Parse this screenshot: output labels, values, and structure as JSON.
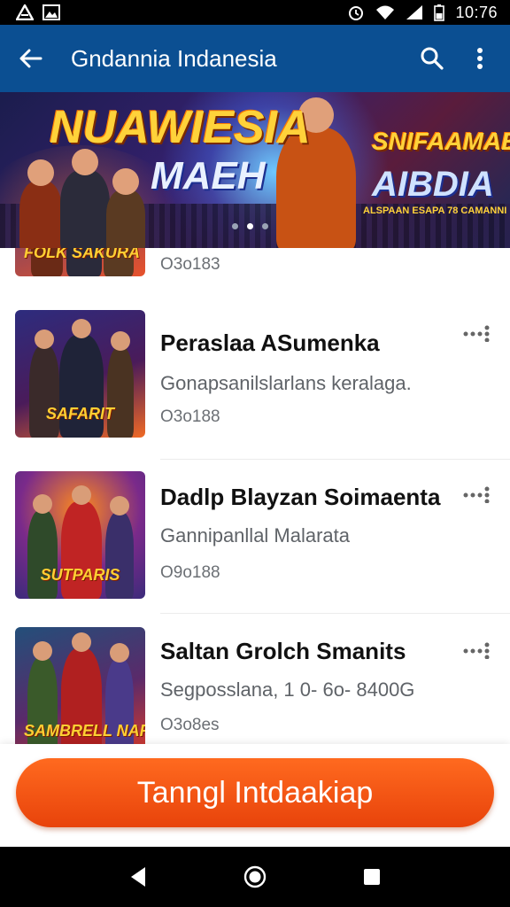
{
  "status_bar": {
    "time": "10:76"
  },
  "app_bar": {
    "title": "Gndannia Indanesia"
  },
  "banner": {
    "line1": "NUAWIESIA",
    "line2": "MAEH",
    "line3": "SNIFAAMAE",
    "line4": "AIBDIA",
    "small_text": "ALSPAAN ESAPA 78 CAMANNI",
    "slide_count": 3,
    "active_slide": 2
  },
  "list": {
    "items": [
      {
        "title": "",
        "subtitle": "",
        "meta": "O3o183",
        "thumb_logo": "FOLK SAKURA",
        "colors": [
          "#2c3a8a",
          "#e8522b"
        ]
      },
      {
        "title": "Peraslaa ASumenka",
        "subtitle": "Gonapsanilslarlans keralaga.",
        "meta": "O3o188",
        "thumb_logo": "SAFARIT",
        "colors": [
          "#2d2c7e",
          "#f06a25"
        ]
      },
      {
        "title": "Dadlp Blayzan  Soimaenta",
        "subtitle": "Gannipanllal Malarata",
        "meta": "O9o188",
        "thumb_logo": "SUTPARIS",
        "colors": [
          "#3b2b7a",
          "#ff8a1d"
        ]
      },
      {
        "title": "Saltan Grolch Smanits",
        "subtitle": "Segposslana, 1 0- 6o- 8400G",
        "meta": "O3o8es",
        "thumb_logo": "SAMBRELL NARDS",
        "colors": [
          "#234f7a",
          "#d93a2a"
        ]
      }
    ]
  },
  "cta": {
    "label": "Tanngl Intdaakiap"
  },
  "colors": {
    "app_bar": "#0b4f92",
    "cta": "#f0541a"
  }
}
